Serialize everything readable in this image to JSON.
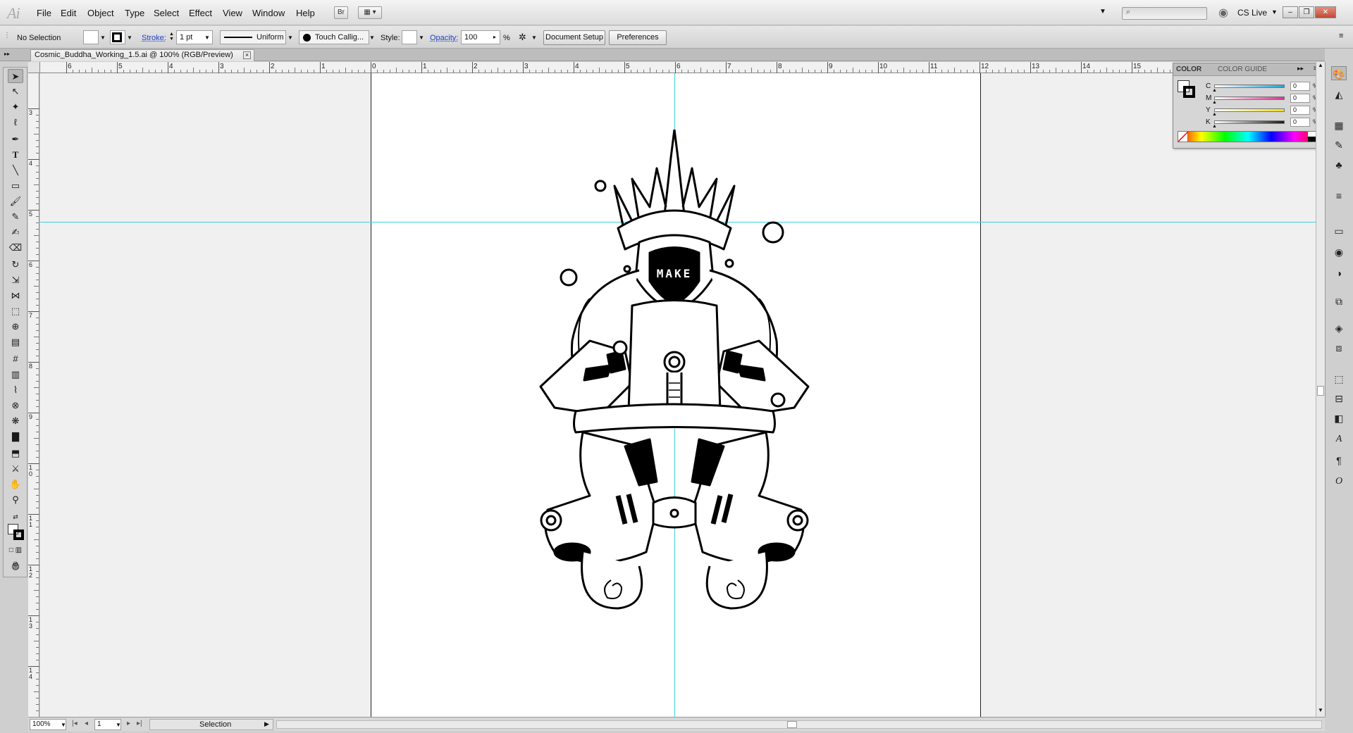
{
  "app": {
    "logo": "Ai",
    "cs_live": "CS Live"
  },
  "menu": [
    "File",
    "Edit",
    "Object",
    "Type",
    "Select",
    "Effect",
    "View",
    "Window",
    "Help"
  ],
  "menubar_buttons": {
    "bridge": "Br"
  },
  "control": {
    "selection_label": "No Selection",
    "stroke_label": "Stroke:",
    "stroke_weight": "1 pt",
    "stroke_profile": "Uniform",
    "brush": "Touch Callig...",
    "style_label": "Style:",
    "opacity_label": "Opacity:",
    "opacity_value": "100",
    "opacity_unit": "%",
    "document_setup": "Document Setup",
    "preferences": "Preferences"
  },
  "document_tab": {
    "title": "Cosmic_Buddha_Working_1.5.ai @ 100% (RGB/Preview)"
  },
  "ruler_h": [
    "6",
    "5",
    "4",
    "3",
    "2",
    "1",
    "0",
    "1",
    "2",
    "3",
    "4",
    "5",
    "6",
    "7",
    "8",
    "9",
    "10",
    "11",
    "12",
    "13",
    "14",
    "15"
  ],
  "ruler_v": [
    "3",
    "4",
    "5",
    "6",
    "7",
    "8",
    "9",
    "10",
    "11",
    "12",
    "13",
    "14"
  ],
  "artwork": {
    "text": "MAKE"
  },
  "color_panel": {
    "tab_color": "COLOR",
    "tab_guide": "COLOR GUIDE",
    "channels": [
      {
        "label": "C",
        "value": "0",
        "color": "#19a8d8"
      },
      {
        "label": "M",
        "value": "0",
        "color": "#e0318f"
      },
      {
        "label": "Y",
        "value": "0",
        "color": "#f0e020"
      },
      {
        "label": "K",
        "value": "0",
        "color": "#1c1c1c"
      }
    ],
    "pct": "%"
  },
  "status": {
    "zoom": "100%",
    "artboard": "1",
    "tool": "Selection"
  },
  "colors": {
    "guide": "#3fd0e0",
    "artboard_border": "#222222",
    "canvas": "#f0f0f0"
  }
}
